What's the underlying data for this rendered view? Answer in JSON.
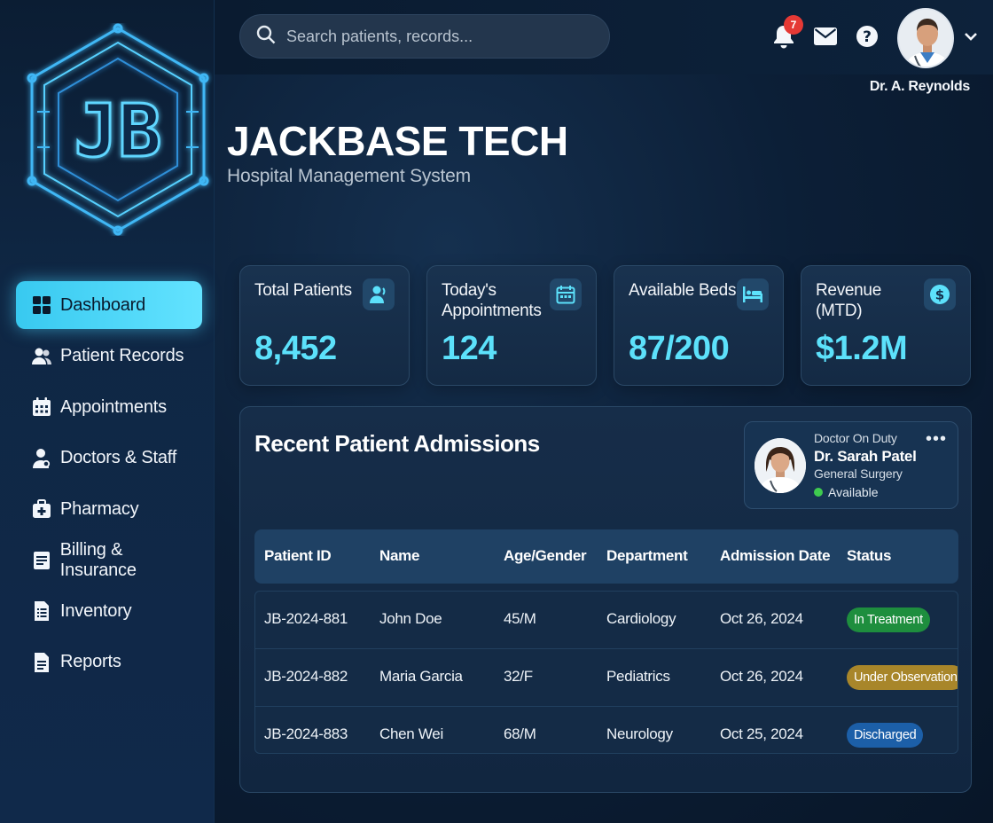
{
  "brand": {
    "logo_letters": "JB",
    "title": "JACKBASE TECH",
    "subtitle": "Hospital Management System"
  },
  "search": {
    "placeholder": "Search patients, records..."
  },
  "header": {
    "notification_count": "7",
    "user_name": "Dr. A. Reynolds"
  },
  "sidebar": {
    "items": [
      {
        "label": "Dashboard",
        "icon": "dashboard-grid-icon",
        "active": true
      },
      {
        "label": "Patient Records",
        "icon": "users-icon",
        "active": false
      },
      {
        "label": "Appointments",
        "icon": "calendar-icon",
        "active": false
      },
      {
        "label": "Doctors & Staff",
        "icon": "doctor-icon",
        "active": false
      },
      {
        "label": "Pharmacy",
        "icon": "medicine-bag-icon",
        "active": false
      },
      {
        "label": "Billing & Insurance",
        "icon": "billing-icon",
        "active": false
      },
      {
        "label": "Inventory",
        "icon": "inventory-icon",
        "active": false
      },
      {
        "label": "Reports",
        "icon": "report-icon",
        "active": false
      }
    ]
  },
  "stats": [
    {
      "label": "Total Patients",
      "value": "8,452",
      "icon": "patient-icon"
    },
    {
      "label": "Today's Appointments",
      "value": "124",
      "icon": "calendar-icon"
    },
    {
      "label": "Available Beds",
      "value": "87/200",
      "icon": "bed-icon"
    },
    {
      "label": "Revenue (MTD)",
      "value": "$1.2M",
      "icon": "dollar-icon"
    }
  ],
  "admissions": {
    "title": "Recent Patient Admissions",
    "columns": [
      "Patient ID",
      "Name",
      "Age/Gender",
      "Department",
      "Admission Date",
      "Status"
    ],
    "rows": [
      {
        "id": "JB-2024-881",
        "name": "John Doe",
        "age_gender": "45/M",
        "department": "Cardiology",
        "date": "Oct 26, 2024",
        "status": "In Treatment",
        "status_color": "#1e8e3e"
      },
      {
        "id": "JB-2024-882",
        "name": "Maria Garcia",
        "age_gender": "32/F",
        "department": "Pediatrics",
        "date": "Oct 26, 2024",
        "status": "Under Observation",
        "status_color": "#a8862a"
      },
      {
        "id": "JB-2024-883",
        "name": "Chen Wei",
        "age_gender": "68/M",
        "department": "Neurology",
        "date": "Oct 25, 2024",
        "status": "Discharged",
        "status_color": "#1c5fa8"
      }
    ]
  },
  "doctor_on_duty": {
    "heading": "Doctor On Duty",
    "name": "Dr. Sarah Patel",
    "specialty": "General Surgery",
    "status": "Available"
  },
  "colors": {
    "accent": "#5ce1fb",
    "active_nav": "#4fd8f8",
    "background": "#0c1f37"
  }
}
